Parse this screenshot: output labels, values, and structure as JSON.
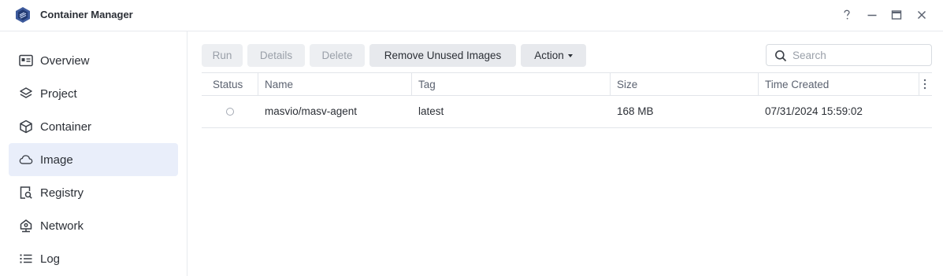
{
  "app": {
    "title": "Container Manager"
  },
  "window_controls": [
    "help-icon",
    "minimize-icon",
    "maximize-icon",
    "close-icon"
  ],
  "sidebar": {
    "items": [
      {
        "label": "Overview",
        "icon": "overview-icon",
        "active": false
      },
      {
        "label": "Project",
        "icon": "layers-icon",
        "active": false
      },
      {
        "label": "Container",
        "icon": "cube-icon",
        "active": false
      },
      {
        "label": "Image",
        "icon": "cloud-icon",
        "active": true
      },
      {
        "label": "Registry",
        "icon": "registry-icon",
        "active": false
      },
      {
        "label": "Network",
        "icon": "network-icon",
        "active": false
      },
      {
        "label": "Log",
        "icon": "list-icon",
        "active": false
      }
    ]
  },
  "toolbar": {
    "run": "Run",
    "details": "Details",
    "delete": "Delete",
    "remove_unused": "Remove Unused Images",
    "action": "Action"
  },
  "search": {
    "placeholder": "Search",
    "value": ""
  },
  "table": {
    "columns": [
      "Status",
      "Name",
      "Tag",
      "Size",
      "Time Created"
    ],
    "rows": [
      {
        "status": "stopped",
        "name": "masvio/masv-agent",
        "tag": "latest",
        "size": "168 MB",
        "time_created": "07/31/2024 15:59:02"
      }
    ]
  },
  "colors": {
    "accent": "#2b5ea7",
    "active_nav_bg": "#e9eefa",
    "border": "#e2e5ea"
  }
}
